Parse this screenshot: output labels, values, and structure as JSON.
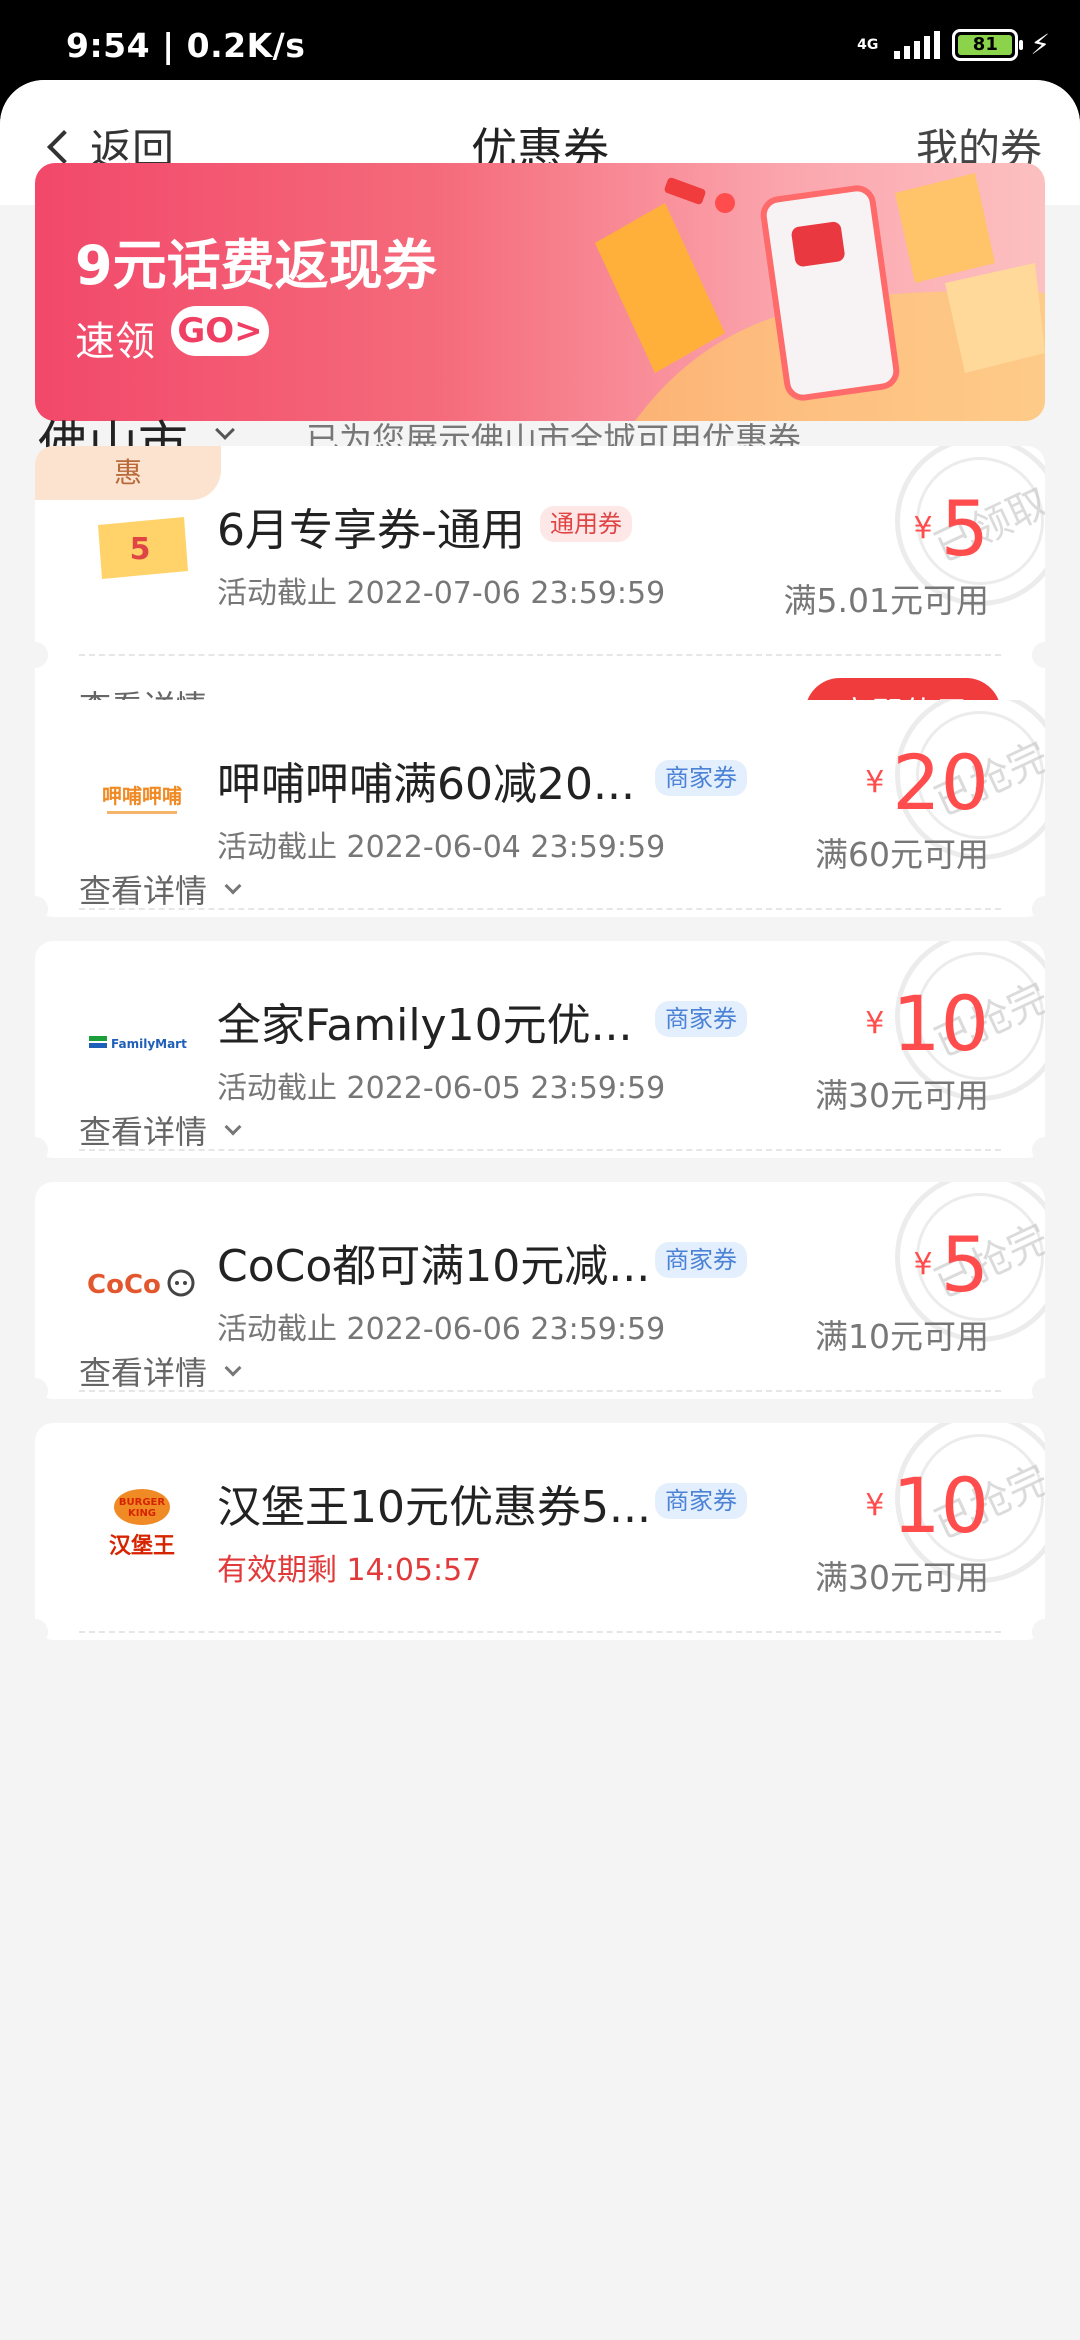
{
  "status_bar": {
    "time_speed": "9:54 | 0.2K/s",
    "network": "4G",
    "battery": "81"
  },
  "nav": {
    "back_label": "返回",
    "title": "优惠券",
    "right_label": "我的券"
  },
  "banner": {
    "title": "9元话费返现券",
    "subtitle": "速领",
    "go_label": "GO>"
  },
  "city": {
    "name": "佛山市",
    "note": "已为您展示佛山市全城可用优惠券"
  },
  "coupons": [
    {
      "tag": "惠",
      "title": "6月专享券-通用",
      "badge": "通用券",
      "deadline": "活动截止 2022-07-06 23:59:59",
      "currency": "¥",
      "amount": "5",
      "condition": "满5.01元可用",
      "stamp": "已领取",
      "details_label": "查看详情",
      "use_label": "立即使用"
    },
    {
      "title": "呷哺呷哺满60减20...",
      "badge": "商家券",
      "deadline": "活动截止 2022-06-04 23:59:59",
      "currency": "¥",
      "amount": "20",
      "condition": "满60元可用",
      "stamp": "已抢完",
      "details_label": "查看详情"
    },
    {
      "title": "全家Family10元优...",
      "badge": "商家券",
      "deadline": "活动截止 2022-06-05 23:59:59",
      "currency": "¥",
      "amount": "10",
      "condition": "满30元可用",
      "stamp": "已抢完",
      "details_label": "查看详情"
    },
    {
      "title": "CoCo都可满10元减...",
      "badge": "商家券",
      "deadline": "活动截止 2022-06-06 23:59:59",
      "currency": "¥",
      "amount": "5",
      "condition": "满10元可用",
      "stamp": "已抢完",
      "details_label": "查看详情"
    },
    {
      "title": "汉堡王10元优惠券5...",
      "badge": "商家券",
      "deadline": "有效期剩 14:05:57",
      "currency": "¥",
      "amount": "10",
      "condition": "满30元可用",
      "stamp": "已抢完"
    }
  ]
}
